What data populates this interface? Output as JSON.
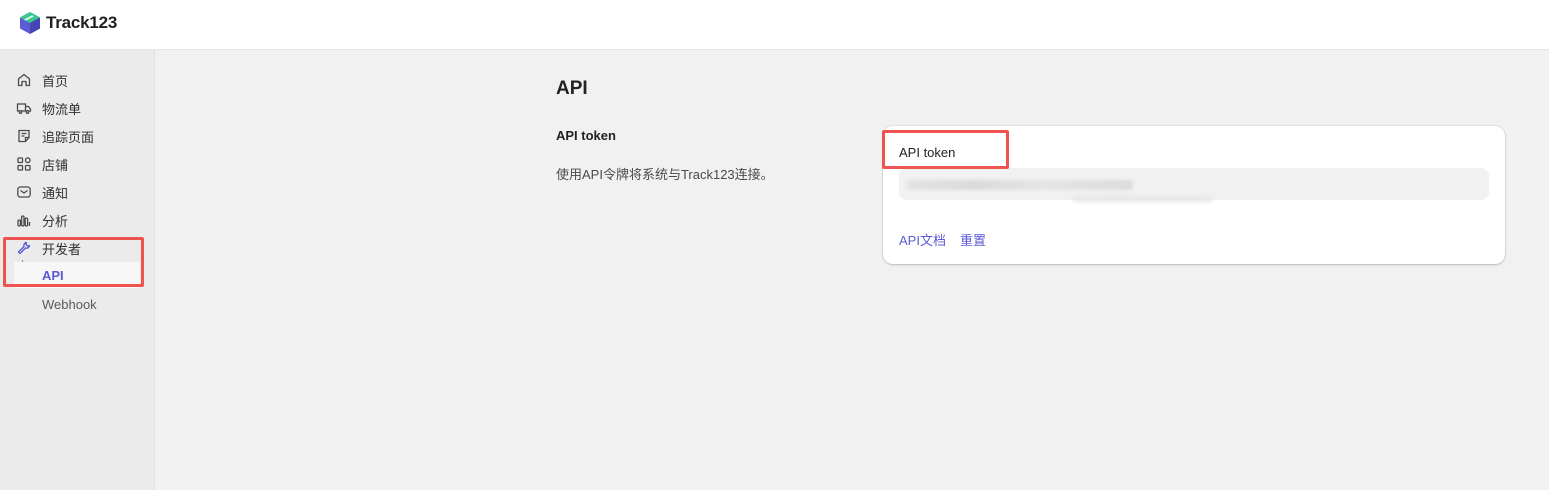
{
  "app": {
    "brand_name": "Track123"
  },
  "sidebar": {
    "items": [
      {
        "label": "首页",
        "icon": "home-icon"
      },
      {
        "label": "物流单",
        "icon": "truck-icon"
      },
      {
        "label": "追踪页面",
        "icon": "document-icon"
      },
      {
        "label": "店铺",
        "icon": "apps-icon"
      },
      {
        "label": "通知",
        "icon": "mail-icon"
      },
      {
        "label": "分析",
        "icon": "chart-icon"
      },
      {
        "label": "开发者",
        "icon": "wrench-icon"
      }
    ],
    "sub_items": [
      {
        "label": "API",
        "active": true
      },
      {
        "label": "Webhook",
        "active": false
      }
    ]
  },
  "main": {
    "title": "API",
    "section_title": "API token",
    "section_description": "使用API令牌将系统与Track123连接。",
    "card": {
      "label": "API token",
      "links": {
        "docs": "API文档",
        "reset": "重置"
      }
    }
  },
  "colors": {
    "accent": "#5b5bd6",
    "highlight": "#ef5350",
    "page_bg": "#f1f1f1",
    "sidebar_bg": "#ebebeb"
  }
}
